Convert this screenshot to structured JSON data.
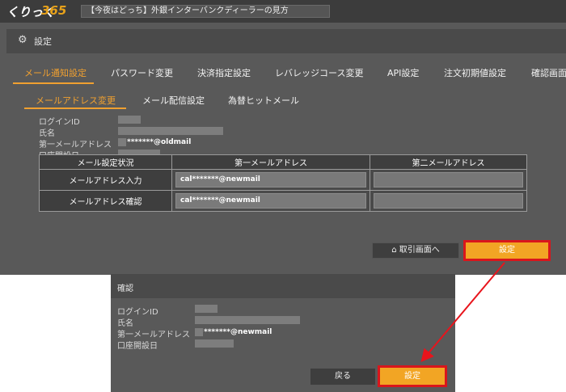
{
  "header": {
    "logo_part1": "くりっく",
    "logo_part2": "365",
    "news": "【今夜はどっち】外銀インターバンクディーラーの見方"
  },
  "settings": {
    "title": "設定",
    "tabs": [
      "メール通知設定",
      "パスワード変更",
      "決済指定設定",
      "レバレッジコース変更",
      "API設定",
      "注文初期値設定",
      "確認画面"
    ],
    "subtabs": [
      "メールアドレス変更",
      "メール配信設定",
      "為替ヒットメール"
    ],
    "info_labels": [
      "ログインID",
      "氏名",
      "第一メールアドレス",
      "口座開設日"
    ],
    "current_email": "*******@oldmail",
    "help": "?",
    "table": {
      "headers": [
        "メール設定状況",
        "第一メールアドレス",
        "第二メールアドレス"
      ],
      "rows": [
        {
          "label": "メールアドレス入力",
          "first": "cal*******@newmail",
          "second": ""
        },
        {
          "label": "メールアドレス確認",
          "first": "cal*******@newmail",
          "second": ""
        }
      ]
    },
    "home_button": "取引画面へ",
    "set_button": "設定"
  },
  "confirm": {
    "title": "確認",
    "info_labels": [
      "ログインID",
      "氏名",
      "第一メールアドレス",
      "口座開設日"
    ],
    "email": "*******@newmail",
    "back_button": "戻る",
    "set_button": "設定"
  },
  "colors": {
    "accent": "#f0a030",
    "highlight_border": "#d9161c",
    "panel_bg": "#595959"
  }
}
